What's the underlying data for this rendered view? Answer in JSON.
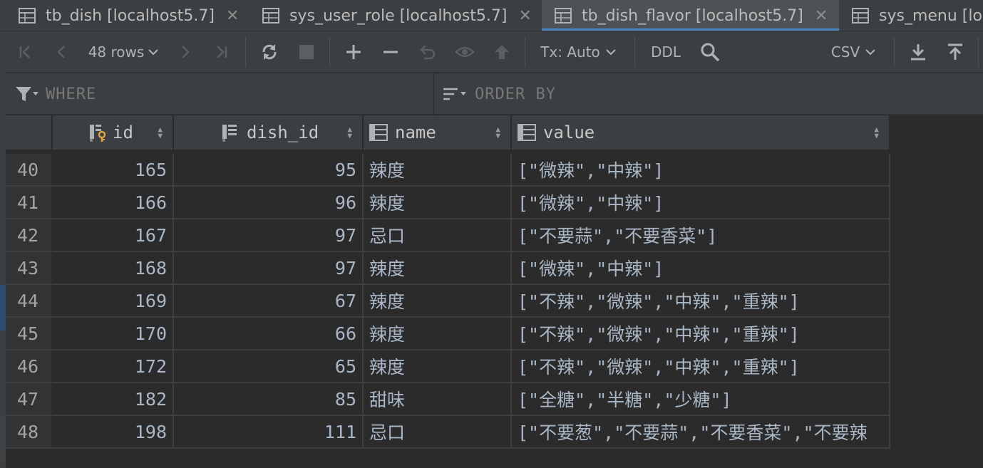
{
  "tabs": [
    {
      "label": "tb_dish [localhost5.7]",
      "active": false
    },
    {
      "label": "sys_user_role [localhost5.7]",
      "active": false
    },
    {
      "label": "tb_dish_flavor [localhost5.7]",
      "active": true
    },
    {
      "label": "sys_menu [lo",
      "active": false
    }
  ],
  "toolbar": {
    "rows_label": "48 rows",
    "tx_label": "Tx: Auto",
    "ddl_label": "DDL",
    "export_format": "CSV"
  },
  "filter": {
    "where_label": "WHERE",
    "order_label": "ORDER BY"
  },
  "columns": [
    {
      "name": "id"
    },
    {
      "name": "dish_id"
    },
    {
      "name": "name"
    },
    {
      "name": "value"
    }
  ],
  "rows": [
    {
      "rn": "40",
      "id": "165",
      "dish_id": "95",
      "name": "辣度",
      "value": "[\"微辣\",\"中辣\"]"
    },
    {
      "rn": "41",
      "id": "166",
      "dish_id": "96",
      "name": "辣度",
      "value": "[\"微辣\",\"中辣\"]"
    },
    {
      "rn": "42",
      "id": "167",
      "dish_id": "97",
      "name": "忌口",
      "value": "[\"不要蒜\",\"不要香菜\"]"
    },
    {
      "rn": "43",
      "id": "168",
      "dish_id": "97",
      "name": "辣度",
      "value": "[\"微辣\",\"中辣\"]"
    },
    {
      "rn": "44",
      "id": "169",
      "dish_id": "67",
      "name": "辣度",
      "value": "[\"不辣\",\"微辣\",\"中辣\",\"重辣\"]"
    },
    {
      "rn": "45",
      "id": "170",
      "dish_id": "66",
      "name": "辣度",
      "value": "[\"不辣\",\"微辣\",\"中辣\",\"重辣\"]"
    },
    {
      "rn": "46",
      "id": "172",
      "dish_id": "65",
      "name": "辣度",
      "value": "[\"不辣\",\"微辣\",\"中辣\",\"重辣\"]"
    },
    {
      "rn": "47",
      "id": "182",
      "dish_id": "85",
      "name": "甜味",
      "value": "[\"全糖\",\"半糖\",\"少糖\"]"
    },
    {
      "rn": "48",
      "id": "198",
      "dish_id": "111",
      "name": "忌口",
      "value": "[\"不要葱\",\"不要蒜\",\"不要香菜\",\"不要辣"
    }
  ]
}
